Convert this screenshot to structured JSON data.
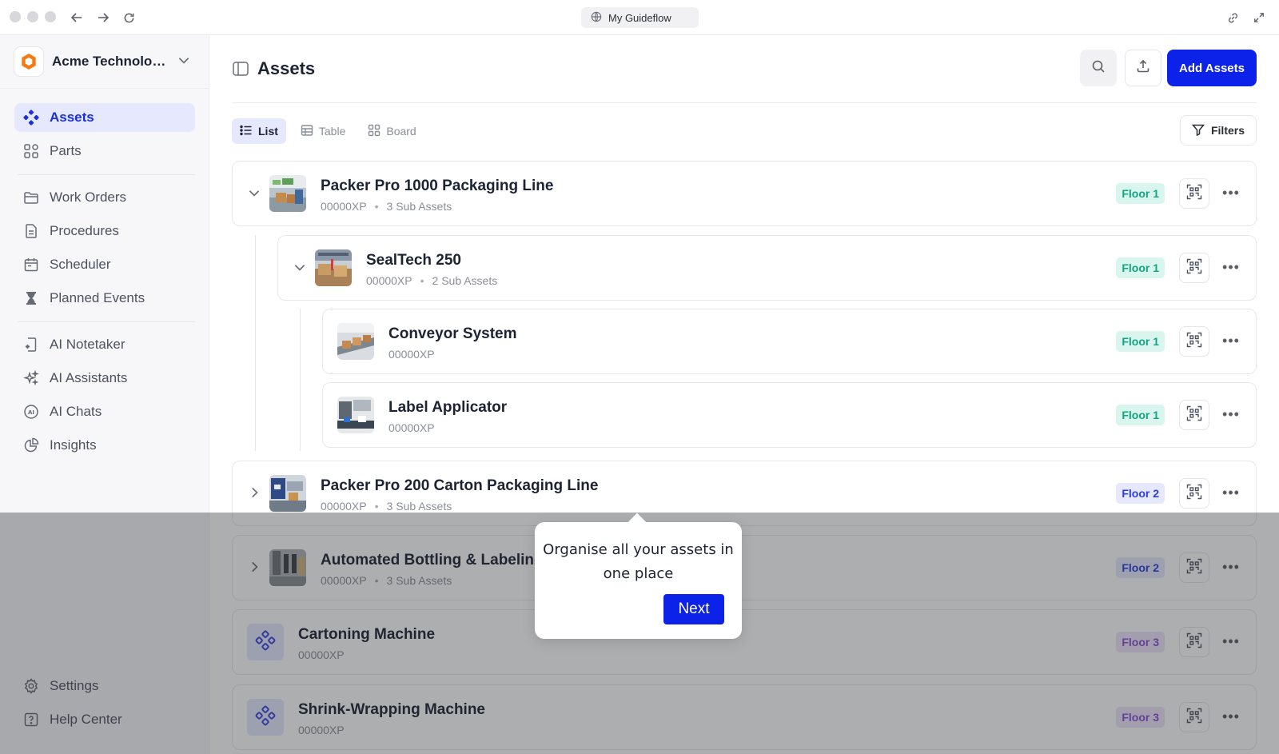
{
  "browser": {
    "url_title": "My Guideflow"
  },
  "sidebar": {
    "workspace_name": "Acme Technologies",
    "items": [
      {
        "label": "Assets",
        "icon": "assets-icon"
      },
      {
        "label": "Parts",
        "icon": "parts-icon"
      },
      {
        "label": "Work Orders",
        "icon": "folder-icon"
      },
      {
        "label": "Procedures",
        "icon": "document-icon"
      },
      {
        "label": "Scheduler",
        "icon": "calendar-icon"
      },
      {
        "label": "Planned Events",
        "icon": "hourglass-icon"
      },
      {
        "label": "AI Notetaker",
        "icon": "ai-notetaker-icon"
      },
      {
        "label": "AI Assistants",
        "icon": "sparkles-icon"
      },
      {
        "label": "AI Chats",
        "icon": "ai-chat-icon"
      },
      {
        "label": "Insights",
        "icon": "pie-chart-icon"
      },
      {
        "label": "Settings",
        "icon": "gear-icon"
      },
      {
        "label": "Help Center",
        "icon": "help-icon"
      }
    ]
  },
  "header": {
    "title": "Assets",
    "add_label": "Add Assets"
  },
  "view_tabs": [
    {
      "label": "List",
      "active": true
    },
    {
      "label": "Table",
      "active": false
    },
    {
      "label": "Board",
      "active": false
    }
  ],
  "filters_label": "Filters",
  "assets": [
    {
      "name": "Packer Pro 1000 Packaging Line",
      "code": "00000XP",
      "sub": "3 Sub Assets",
      "floor": "Floor 1",
      "expanded": true
    },
    {
      "name": "SealTech 250",
      "code": "00000XP",
      "sub": "2 Sub Assets",
      "floor": "Floor 1",
      "expanded": true
    },
    {
      "name": "Conveyor System",
      "code": "00000XP",
      "sub": "",
      "floor": "Floor 1"
    },
    {
      "name": "Label Applicator",
      "code": "00000XP",
      "sub": "",
      "floor": "Floor 1"
    },
    {
      "name": "Packer Pro 200 Carton Packaging Line",
      "code": "00000XP",
      "sub": "3 Sub Assets",
      "floor": "Floor 2",
      "expanded": false
    },
    {
      "name": "Automated Bottling & Labeling",
      "code": "00000XP",
      "sub": "3 Sub Assets",
      "floor": "Floor 2",
      "expanded": false
    },
    {
      "name": "Cartoning Machine",
      "code": "00000XP",
      "sub": "",
      "floor": "Floor 3"
    },
    {
      "name": "Shrink-Wrapping Machine",
      "code": "00000XP",
      "sub": "",
      "floor": "Floor 3"
    }
  ],
  "colors": {
    "accent": "#0c22e8",
    "floor1": "#13a383",
    "floor2": "#2c3ddd",
    "floor3": "#8a4fd8"
  },
  "tour": {
    "message": "Organise all your assets in one place",
    "next_label": "Next"
  }
}
